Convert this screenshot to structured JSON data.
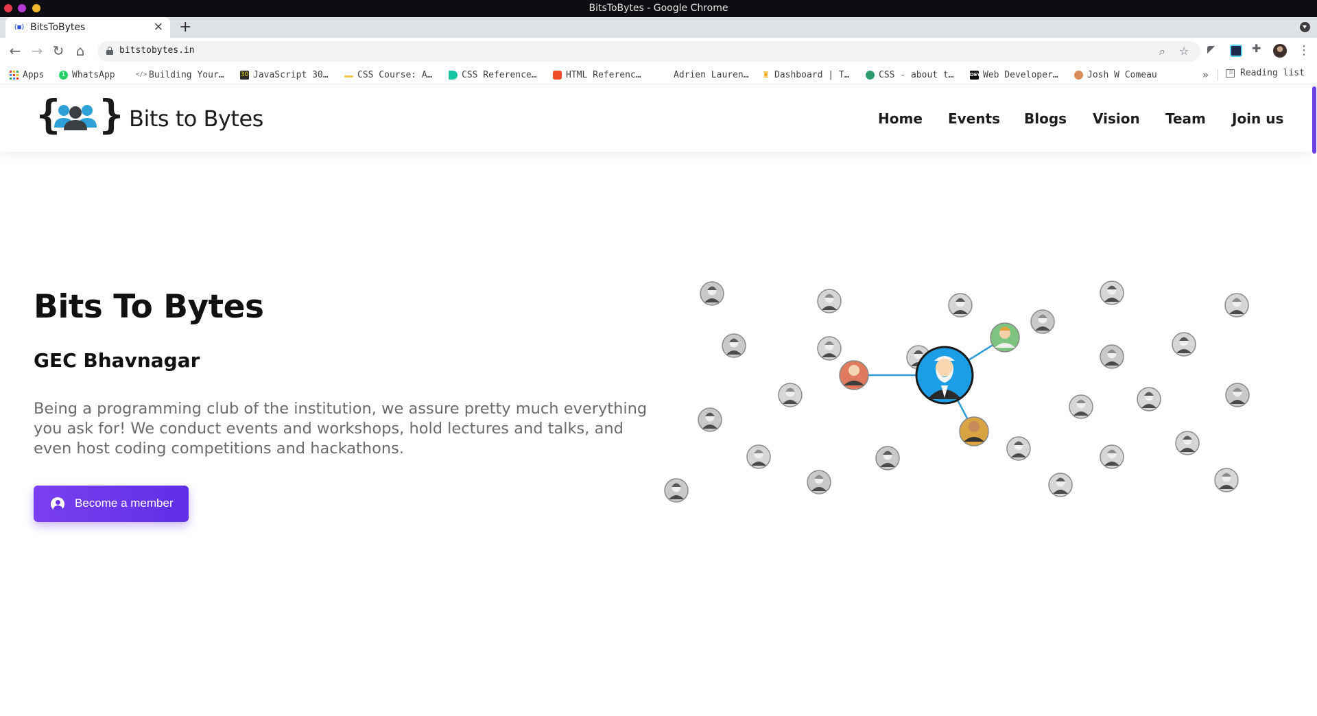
{
  "browser": {
    "window_title": "BitsToBytes - Google Chrome",
    "tab": {
      "favicon_text": "{■}",
      "title": "BitsToBytes"
    },
    "url": "bitstobytes.in",
    "bookmarks": [
      {
        "label": "Apps",
        "icon": "apps-grid-icon"
      },
      {
        "label": "WhatsApp",
        "icon": "whatsapp-icon",
        "color": "#25d366"
      },
      {
        "label": "Building Your…",
        "icon": "code-icon"
      },
      {
        "label": "JavaScript 30…",
        "icon": "js30-icon",
        "color": "#2b2b2b"
      },
      {
        "label": "CSS Course: A…",
        "icon": "css-course-icon",
        "color": "#f2c94c"
      },
      {
        "label": "CSS Reference…",
        "icon": "css-reference-icon",
        "color": "#17c3a3"
      },
      {
        "label": "HTML Referenc…",
        "icon": "html-reference-icon",
        "color": "#ef4b24"
      },
      {
        "label": "Adrien Lauren…",
        "icon": "blank-icon"
      },
      {
        "label": "Dashboard | T…",
        "icon": "trophy-icon",
        "color": "#f2a900"
      },
      {
        "label": "CSS - about t…",
        "icon": "globe-icon",
        "color": "#2e9b6f"
      },
      {
        "label": "Web Developer…",
        "icon": "dev-icon",
        "color": "#111111"
      },
      {
        "label": "Josh W Comeau",
        "icon": "josh-avatar-icon",
        "color": "#d98b58"
      }
    ],
    "bookmark_overflow": "»",
    "reading_list": "Reading list"
  },
  "site": {
    "brand": "Bits to Bytes",
    "nav": [
      "Home",
      "Events",
      "Blogs",
      "Vision",
      "Team",
      "Join us"
    ],
    "accent_color": "#6a34ea",
    "hero": {
      "title": "Bits To Bytes",
      "subtitle": "GEC Bhavnagar",
      "description": "Being a programming club of the institution, we assure pretty much everything you ask for! We conduct events and workshops, hold lectures and talks, and even host coding competitions and hackathons.",
      "cta_label": "Become a member"
    }
  }
}
